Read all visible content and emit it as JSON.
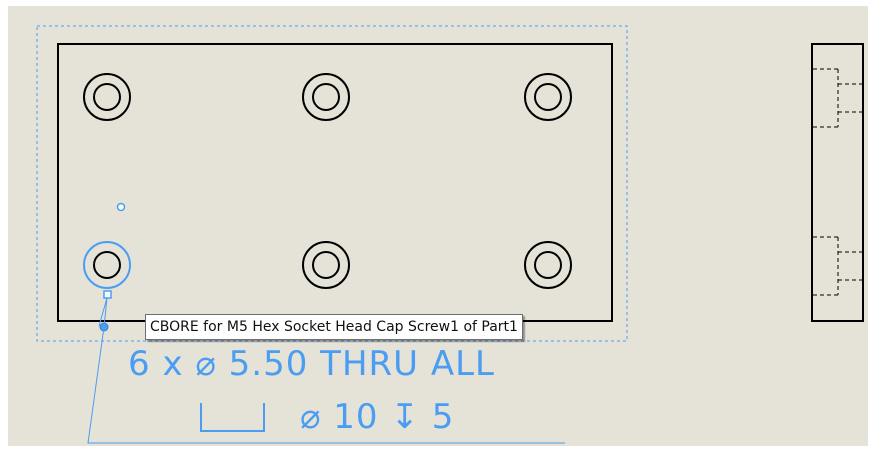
{
  "tooltip": {
    "text": "CBORE for M5 Hex Socket Head Cap Screw1 of Part1"
  },
  "hole_callout": {
    "line1_count": "6 x",
    "line1_diameter_symbol": "⌀",
    "line1_value": "5.50 THRU ALL",
    "line2_diameter_symbol": "⌀",
    "line2_cbore_diameter": "10",
    "line2_depth_symbol": "↧",
    "line2_depth": "5"
  },
  "colors": {
    "sheet_background": "#e5e2d8",
    "geometry": "#000000",
    "selection_highlight": "#4a9df2"
  },
  "icons": [
    "counterbore-symbol-icon",
    "diameter-symbol-icon",
    "depth-symbol-icon",
    "grip-handle-icon"
  ]
}
